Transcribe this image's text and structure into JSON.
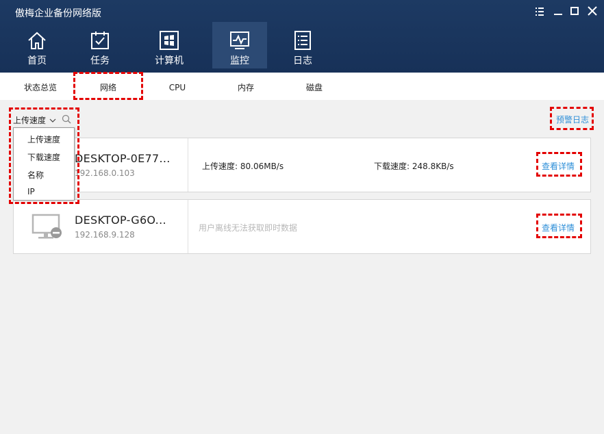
{
  "app": {
    "title": "傲梅企业备份网络版"
  },
  "window_controls": [
    "menu-icon",
    "minimize-icon",
    "maximize-icon",
    "close-icon"
  ],
  "nav": [
    {
      "label": "首页",
      "icon": "home-icon"
    },
    {
      "label": "任务",
      "icon": "task-icon"
    },
    {
      "label": "计算机",
      "icon": "computer-icon"
    },
    {
      "label": "监控",
      "icon": "monitor-icon",
      "active": true
    },
    {
      "label": "日志",
      "icon": "log-icon"
    }
  ],
  "subnav": [
    {
      "label": "状态总览"
    },
    {
      "label": "网络",
      "active": true
    },
    {
      "label": "CPU"
    },
    {
      "label": "内存"
    },
    {
      "label": "磁盘"
    }
  ],
  "filter": {
    "selected": "上传速度",
    "options": [
      "上传速度",
      "下载速度",
      "名称",
      "IP"
    ]
  },
  "alert_log_label": "预警日志",
  "devices": [
    {
      "name": "DESKTOP-0E77...",
      "ip": "192.168.0.103",
      "upload_label": "上传速度: 80.06MB/s",
      "download_label": "下载速度: 248.8KB/s",
      "details_label": "查看详情",
      "online": true
    },
    {
      "name": "DESKTOP-G6O...",
      "ip": "192.168.9.128",
      "offline_text": "用户离线无法获取即时数据",
      "details_label": "查看详情",
      "online": false
    }
  ],
  "colors": {
    "header": "#1d3a63",
    "active_nav": "#2c4a74",
    "link": "#2f8fd8",
    "highlight": "#e30000"
  }
}
